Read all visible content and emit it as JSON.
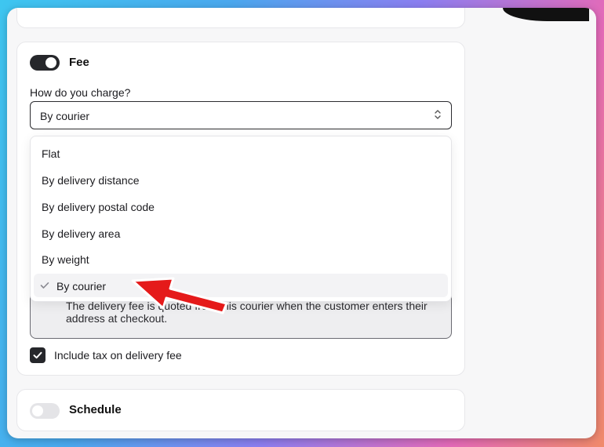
{
  "fee": {
    "toggle_on": true,
    "title": "Fee",
    "charge_label": "How do you charge?",
    "selected_value": "By courier",
    "options": [
      {
        "label": "Flat",
        "selected": false
      },
      {
        "label": "By delivery distance",
        "selected": false
      },
      {
        "label": "By delivery postal code",
        "selected": false
      },
      {
        "label": "By delivery area",
        "selected": false
      },
      {
        "label": "By weight",
        "selected": false
      },
      {
        "label": "By courier",
        "selected": true
      }
    ],
    "info_text": "The delivery fee is quoted from this courier when the customer enters their address at checkout.",
    "include_tax_label": "Include tax on delivery fee",
    "include_tax_checked": true
  },
  "schedule": {
    "toggle_on": false,
    "title": "Schedule"
  },
  "icons": {
    "select": "chevron-up-down-icon",
    "check": "checkmark-icon",
    "annotation": "red-arrow"
  },
  "colors": {
    "toggle_on": "#26272b",
    "toggle_off": "#e4e4e7",
    "arrow": "#e51a1a"
  }
}
